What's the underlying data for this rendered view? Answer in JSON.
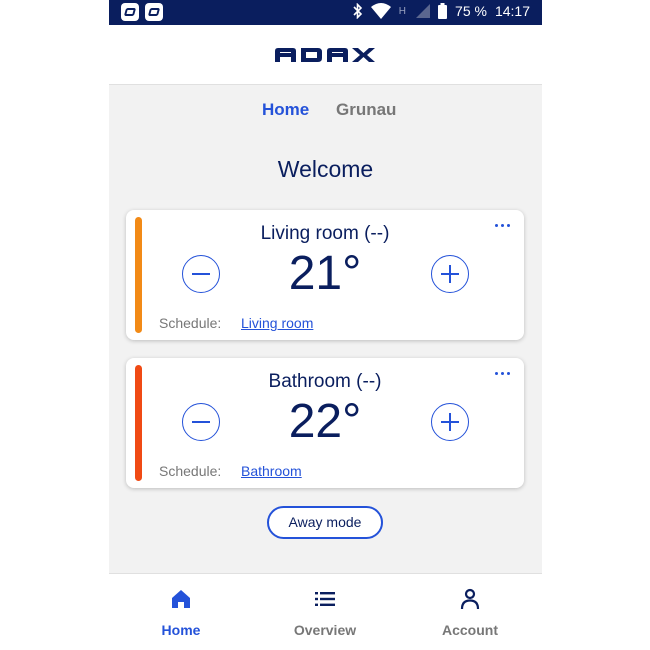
{
  "status_bar": {
    "battery": "75 %",
    "time": "14:17",
    "network": "H"
  },
  "header": {
    "logo_text": "ADAX"
  },
  "tabs": [
    {
      "label": "Home",
      "active": true
    },
    {
      "label": "Grunau",
      "active": false
    }
  ],
  "welcome": "Welcome",
  "rooms": [
    {
      "name": "Living room (--)",
      "temperature": "21°",
      "schedule_label": "Schedule:",
      "schedule_link": "Living room",
      "stripe_color": "#f28a16"
    },
    {
      "name": "Bathroom (--)",
      "temperature": "22°",
      "schedule_label": "Schedule:",
      "schedule_link": "Bathroom",
      "stripe_color": "#f04a14"
    }
  ],
  "away_mode": "Away mode",
  "bottom_nav": [
    {
      "label": "Home",
      "icon": "home-icon",
      "active": true
    },
    {
      "label": "Overview",
      "icon": "list-icon",
      "active": false
    },
    {
      "label": "Account",
      "icon": "person-icon",
      "active": false
    }
  ],
  "colors": {
    "primary": "#2452d9",
    "navy": "#0a1e5e",
    "gray_text": "#777777",
    "background": "#f2f2f2"
  }
}
